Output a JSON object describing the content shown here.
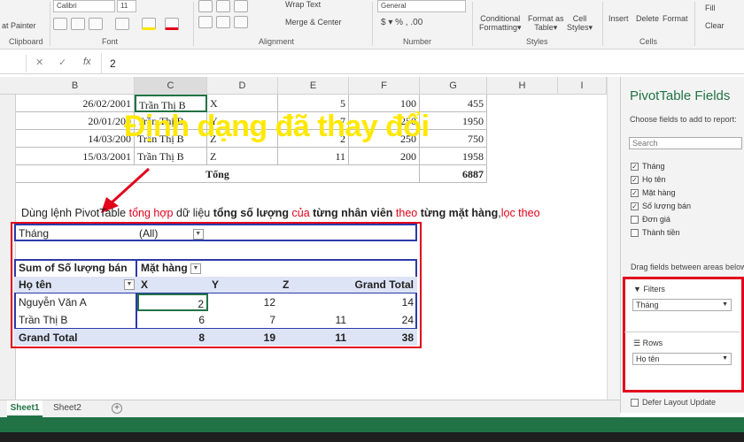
{
  "ribbon": {
    "clipboard_painter": "at Painter",
    "clipboard_group": "Clipboard",
    "font_name": "Calibri",
    "font_size": "11",
    "font_group": "Font",
    "wrap_text": "Wrap Text",
    "merge_center": "Merge & Center",
    "alignment_group": "Alignment",
    "number_format": "General",
    "number_group": "Number",
    "conditional": [
      "Conditional",
      "Formatting"
    ],
    "format_table": [
      "Format as",
      "Table"
    ],
    "cell_styles": [
      "Cell",
      "Styles"
    ],
    "styles_group": "Styles",
    "insert": "Insert",
    "delete": "Delete",
    "format": "Format",
    "cells_group": "Cells",
    "fill": "Fill",
    "clear": "Clear"
  },
  "formula": {
    "value": "2",
    "cancel": "✕",
    "enter": "✓",
    "fx": "fx"
  },
  "columns": [
    "B",
    "C",
    "D",
    "E",
    "F",
    "G",
    "H",
    "I"
  ],
  "rows": [
    {
      "b": "26/02/2001",
      "c": "Trần Thị B",
      "d": "X",
      "e": "5",
      "f": "100",
      "g": "455"
    },
    {
      "b": "20/01/200",
      "c": "Trần Thị B",
      "d": "Y",
      "e": "7",
      "f": "250",
      "g": "1950"
    },
    {
      "b": "14/03/200",
      "c": "Trần Thị B",
      "d": "Z",
      "e": "2",
      "f": "250",
      "g": "750"
    },
    {
      "b": "15/03/2001",
      "c": "Trần Thị B",
      "d": "Z",
      "e": "11",
      "f": "200",
      "g": "1958"
    }
  ],
  "total": {
    "label": "Tổng",
    "value": "6887"
  },
  "annotation": "Định dạng đã thay đổi",
  "instruction": {
    "p1": "Dùng lệnh PivotTable ",
    "p2": "tổng hợp",
    "p3": " dữ liệu ",
    "p4": "tổng số lượng",
    "p5": " của ",
    "p6": "từng nhân viên",
    "p7": " theo ",
    "p8": "từng mặt hàng",
    ",": ",",
    "p9": "lọc theo"
  },
  "pivot": {
    "filter_label": "Tháng",
    "filter_value": "(All)",
    "values_label": "Sum of Số lượng bán",
    "col_label": "Mặt hàng",
    "row_label": "Họ tên",
    "col_heads": [
      "X",
      "Y",
      "Z",
      "Grand Total"
    ],
    "data": [
      {
        "name": "Nguyễn Văn A",
        "x": "2",
        "y": "12",
        "z": "",
        "t": "14"
      },
      {
        "name": "Trần Thị B",
        "x": "6",
        "y": "7",
        "z": "11",
        "t": "24"
      }
    ],
    "grand": {
      "name": "Grand Total",
      "x": "8",
      "y": "19",
      "z": "11",
      "t": "38"
    }
  },
  "pane": {
    "title": "PivotTable Fields",
    "subtitle": "Choose fields to add to report:",
    "search": "Search",
    "fields": [
      "Tháng",
      "Họ tên",
      "Mặt hàng",
      "Số lượng bán",
      "Đơn giá",
      "Thành tiền"
    ],
    "checked": [
      true,
      true,
      true,
      true,
      false,
      false
    ],
    "drag_text": "Drag fields between areas below",
    "filters_label": "Filters",
    "filters_value": "Tháng",
    "rows_label": "Rows",
    "rows_value": "Họ tên",
    "defer": "Defer Layout Update"
  },
  "tabs": [
    "Sheet1",
    "Sheet2"
  ],
  "colors": {
    "accent": "#217346",
    "red": "#e2001a",
    "yellow": "#ffe800"
  }
}
